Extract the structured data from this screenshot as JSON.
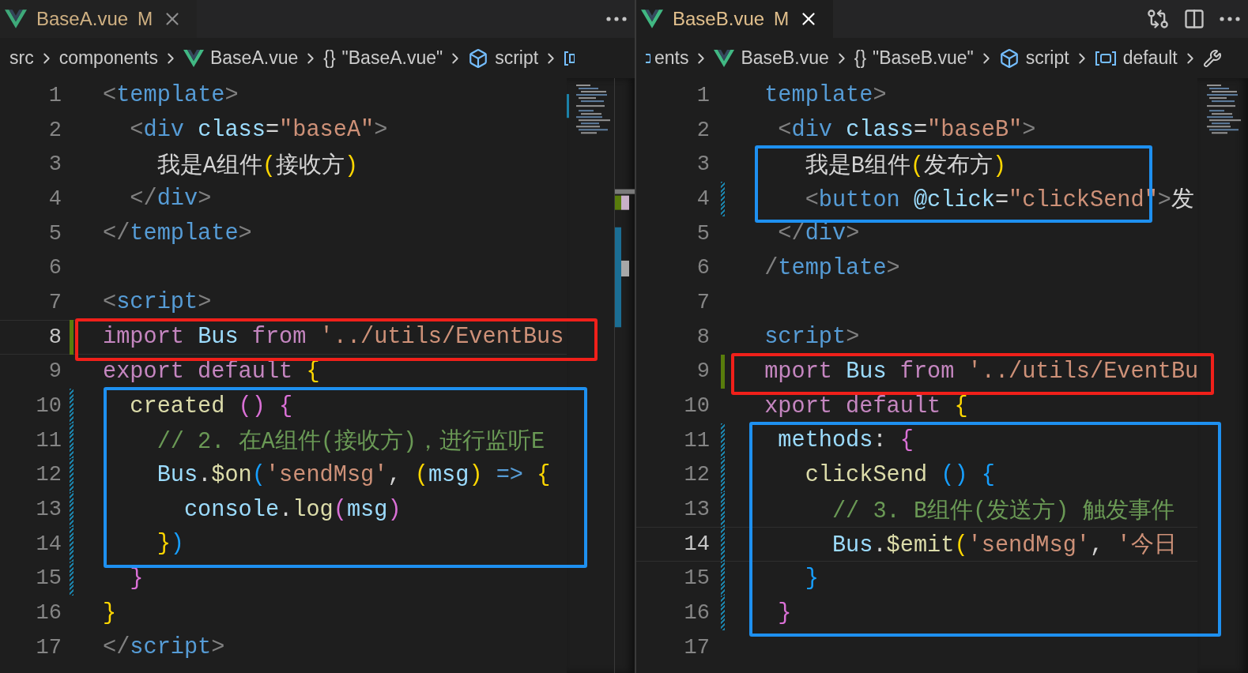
{
  "panes": [
    {
      "tab": {
        "label": "BaseA.vue",
        "status": "M",
        "selected": false
      },
      "breadcrumbs": [
        {
          "kind": "plain",
          "text": "src"
        },
        {
          "kind": "plain",
          "text": "components"
        },
        {
          "kind": "vue",
          "text": "BaseA.vue"
        },
        {
          "kind": "braces",
          "symbol": "{}",
          "text": "\"BaseA.vue\""
        },
        {
          "kind": "cube",
          "text": "script"
        },
        {
          "kind": "field-cut"
        }
      ],
      "frames": [
        {
          "color": "#f0201a"
        },
        {
          "color": "#1e90f0"
        }
      ],
      "lines": [
        {
          "number": "1",
          "current": false,
          "tokens": [
            {
              "text": "<",
              "color": "#808080"
            },
            {
              "text": "template",
              "color": "#569cd6"
            },
            {
              "text": ">",
              "color": "#808080"
            }
          ]
        },
        {
          "number": "2",
          "current": false,
          "tokens": [
            {
              "text": "  <",
              "color": "#808080"
            },
            {
              "text": "div",
              "color": "#569cd6"
            },
            {
              "text": " class",
              "color": "#9cdcfe"
            },
            {
              "text": "=",
              "color": "#d4d4d4"
            },
            {
              "text": "\"baseA\"",
              "color": "#ce9178"
            },
            {
              "text": ">",
              "color": "#808080"
            }
          ]
        },
        {
          "number": "3",
          "current": false,
          "tokens": [
            {
              "text": "    我是A组件",
              "color": "#d4d4d4"
            },
            {
              "text": "(",
              "color": "#ffd700"
            },
            {
              "text": "接收方",
              "color": "#d4d4d4"
            },
            {
              "text": ")",
              "color": "#ffd700"
            }
          ]
        },
        {
          "number": "4",
          "current": false,
          "tokens": [
            {
              "text": "  </",
              "color": "#808080"
            },
            {
              "text": "div",
              "color": "#569cd6"
            },
            {
              "text": ">",
              "color": "#808080"
            }
          ]
        },
        {
          "number": "5",
          "current": false,
          "tokens": [
            {
              "text": "</",
              "color": "#808080"
            },
            {
              "text": "template",
              "color": "#569cd6"
            },
            {
              "text": ">",
              "color": "#808080"
            }
          ]
        },
        {
          "number": "6",
          "current": false
        },
        {
          "number": "7",
          "current": false,
          "tokens": [
            {
              "text": "<",
              "color": "#808080"
            },
            {
              "text": "script",
              "color": "#569cd6"
            },
            {
              "text": ">",
              "color": "#808080"
            }
          ]
        },
        {
          "number": "8",
          "current": true,
          "change": {
            "kind": "added"
          },
          "tokens": [
            {
              "text": "import ",
              "color": "#c586c0"
            },
            {
              "text": "Bus",
              "color": "#9cdcfe"
            },
            {
              "text": " from",
              "color": "#c586c0"
            },
            {
              "text": " '../utils/EventBus",
              "color": "#ce9178"
            }
          ]
        },
        {
          "number": "9",
          "current": false,
          "tokens": [
            {
              "text": "export default",
              "color": "#c586c0"
            },
            {
              "text": " {",
              "color": "#ffd700"
            }
          ]
        },
        {
          "number": "10",
          "current": false,
          "change": {
            "kind": "modified"
          },
          "tokens": [
            {
              "text": "  created",
              "color": "#dcdcaa"
            },
            {
              "text": " ()",
              "color": "#da70d6"
            },
            {
              "text": " {",
              "color": "#da70d6"
            }
          ]
        },
        {
          "number": "11",
          "current": false,
          "change": {
            "kind": "modified"
          },
          "tokens": [
            {
              "text": "    // 2. 在A组件(接收方)，进行监听E",
              "color": "#6a9955"
            }
          ]
        },
        {
          "number": "12",
          "current": false,
          "change": {
            "kind": "modified"
          },
          "tokens": [
            {
              "text": "    Bus",
              "color": "#9cdcfe"
            },
            {
              "text": ".",
              "color": "#d4d4d4"
            },
            {
              "text": "$on",
              "color": "#dcdcaa"
            },
            {
              "text": "(",
              "color": "#179fff"
            },
            {
              "text": "'sendMsg'",
              "color": "#ce9178"
            },
            {
              "text": ", ",
              "color": "#d4d4d4"
            },
            {
              "text": "(",
              "color": "#ffd700"
            },
            {
              "text": "msg",
              "color": "#9cdcfe"
            },
            {
              "text": ")",
              "color": "#ffd700"
            },
            {
              "text": " =>",
              "color": "#569cd6"
            },
            {
              "text": " {",
              "color": "#ffd700"
            }
          ]
        },
        {
          "number": "13",
          "current": false,
          "change": {
            "kind": "modified"
          },
          "tokens": [
            {
              "text": "      console",
              "color": "#9cdcfe"
            },
            {
              "text": ".",
              "color": "#d4d4d4"
            },
            {
              "text": "log",
              "color": "#dcdcaa"
            },
            {
              "text": "(",
              "color": "#da70d6"
            },
            {
              "text": "msg",
              "color": "#9cdcfe"
            },
            {
              "text": ")",
              "color": "#da70d6"
            }
          ]
        },
        {
          "number": "14",
          "current": false,
          "change": {
            "kind": "modified"
          },
          "tokens": [
            {
              "text": "    }",
              "color": "#ffd700"
            },
            {
              "text": ")",
              "color": "#179fff"
            }
          ]
        },
        {
          "number": "15",
          "current": false,
          "change": {
            "kind": "modified"
          },
          "tokens": [
            {
              "text": "  }",
              "color": "#da70d6"
            }
          ]
        },
        {
          "number": "16",
          "current": false,
          "tokens": [
            {
              "text": "}",
              "color": "#ffd700"
            }
          ]
        },
        {
          "number": "17",
          "current": false,
          "tokens": [
            {
              "text": "</",
              "color": "#808080"
            },
            {
              "text": "script",
              "color": "#569cd6"
            },
            {
              "text": ">",
              "color": "#808080"
            }
          ]
        }
      ]
    },
    {
      "tab": {
        "label": "BaseB.vue",
        "status": "M",
        "selected": true
      },
      "breadcrumbs": [
        {
          "kind": "module-cut",
          "text": "ents"
        },
        {
          "kind": "vue",
          "text": "BaseB.vue"
        },
        {
          "kind": "braces",
          "symbol": "{}",
          "text": "\"BaseB.vue\""
        },
        {
          "kind": "cube",
          "text": "script"
        },
        {
          "kind": "field",
          "text": "default"
        },
        {
          "kind": "wrench-cut"
        }
      ],
      "frames": [
        {
          "color": "#1e90f0"
        },
        {
          "color": "#f0201a"
        },
        {
          "color": "#1e90f0"
        }
      ],
      "lines": [
        {
          "number": "1",
          "current": false,
          "tokens": [
            {
              "text": " template",
              "color": "#569cd6"
            },
            {
              "text": ">",
              "color": "#808080"
            }
          ]
        },
        {
          "number": "2",
          "current": false,
          "tokens": [
            {
              "text": "  <",
              "color": "#808080"
            },
            {
              "text": "div",
              "color": "#569cd6"
            },
            {
              "text": " class",
              "color": "#9cdcfe"
            },
            {
              "text": "=",
              "color": "#d4d4d4"
            },
            {
              "text": "\"baseB\"",
              "color": "#ce9178"
            },
            {
              "text": ">",
              "color": "#808080"
            }
          ]
        },
        {
          "number": "3",
          "current": false,
          "tokens": [
            {
              "text": "    我是B组件",
              "color": "#d4d4d4"
            },
            {
              "text": "(",
              "color": "#ffd700"
            },
            {
              "text": "发布方",
              "color": "#d4d4d4"
            },
            {
              "text": ")",
              "color": "#ffd700"
            }
          ]
        },
        {
          "number": "4",
          "current": false,
          "change": {
            "kind": "modified"
          },
          "tokens": [
            {
              "text": "    <",
              "color": "#808080"
            },
            {
              "text": "button",
              "color": "#569cd6"
            },
            {
              "text": " @click",
              "color": "#9cdcfe"
            },
            {
              "text": "=",
              "color": "#d4d4d4"
            },
            {
              "text": "\"clickSend\"",
              "color": "#ce9178"
            },
            {
              "text": ">",
              "color": "#808080"
            },
            {
              "text": "发",
              "color": "#d4d4d4"
            }
          ]
        },
        {
          "number": "5",
          "current": false,
          "tokens": [
            {
              "text": "  </",
              "color": "#808080"
            },
            {
              "text": "div",
              "color": "#569cd6"
            },
            {
              "text": ">",
              "color": "#808080"
            }
          ]
        },
        {
          "number": "6",
          "current": false,
          "tokens": [
            {
              "text": " /",
              "color": "#808080"
            },
            {
              "text": "template",
              "color": "#569cd6"
            },
            {
              "text": ">",
              "color": "#808080"
            }
          ]
        },
        {
          "number": "7",
          "current": false
        },
        {
          "number": "8",
          "current": false,
          "tokens": [
            {
              "text": " script",
              "color": "#569cd6"
            },
            {
              "text": ">",
              "color": "#808080"
            }
          ]
        },
        {
          "number": "9",
          "current": false,
          "change": {
            "kind": "added"
          },
          "tokens": [
            {
              "text": " mport",
              "color": "#c586c0"
            },
            {
              "text": " Bus",
              "color": "#9cdcfe"
            },
            {
              "text": " from",
              "color": "#c586c0"
            },
            {
              "text": " '../utils/EventBu",
              "color": "#ce9178"
            }
          ]
        },
        {
          "number": "10",
          "current": false,
          "tokens": [
            {
              "text": " xport default",
              "color": "#c586c0"
            },
            {
              "text": " {",
              "color": "#ffd700"
            }
          ]
        },
        {
          "number": "11",
          "current": false,
          "change": {
            "kind": "modified"
          },
          "tokens": [
            {
              "text": "  methods",
              "color": "#9cdcfe"
            },
            {
              "text": ":",
              "color": "#d4d4d4"
            },
            {
              "text": " {",
              "color": "#da70d6"
            }
          ]
        },
        {
          "number": "12",
          "current": false,
          "change": {
            "kind": "modified"
          },
          "tokens": [
            {
              "text": "    clickSend",
              "color": "#dcdcaa"
            },
            {
              "text": " ()",
              "color": "#179fff"
            },
            {
              "text": " {",
              "color": "#179fff"
            }
          ]
        },
        {
          "number": "13",
          "current": false,
          "change": {
            "kind": "modified"
          },
          "tokens": [
            {
              "text": "      // 3. B组件(发送方) 触发事件",
              "color": "#6a9955"
            }
          ]
        },
        {
          "number": "14",
          "current": true,
          "change": {
            "kind": "modified"
          },
          "tokens": [
            {
              "text": "      Bus",
              "color": "#9cdcfe"
            },
            {
              "text": ".",
              "color": "#d4d4d4"
            },
            {
              "text": "$emit",
              "color": "#dcdcaa"
            },
            {
              "text": "(",
              "color": "#ffd700"
            },
            {
              "text": "'sendMsg'",
              "color": "#ce9178"
            },
            {
              "text": ", ",
              "color": "#d4d4d4"
            },
            {
              "text": "'今日",
              "color": "#ce9178"
            }
          ]
        },
        {
          "number": "15",
          "current": false,
          "change": {
            "kind": "modified"
          },
          "tokens": [
            {
              "text": "    }",
              "color": "#179fff"
            }
          ]
        },
        {
          "number": "16",
          "current": false,
          "change": {
            "kind": "modified"
          },
          "tokens": [
            {
              "text": "  }",
              "color": "#da70d6"
            }
          ]
        },
        {
          "number": "17",
          "current": false
        }
      ]
    }
  ]
}
